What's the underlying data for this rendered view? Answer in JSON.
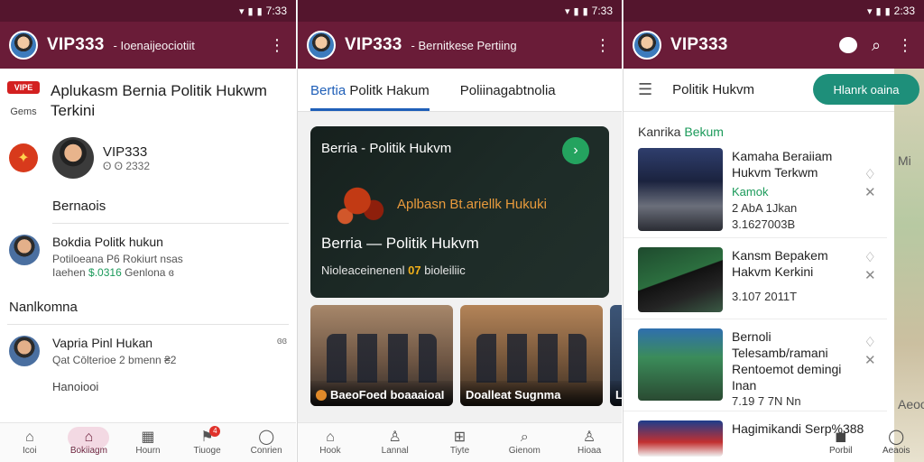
{
  "status": {
    "s1_time": "7:33",
    "s2_time": "7:33",
    "s3_time": "2:33"
  },
  "screen1": {
    "brand": "VIP333",
    "subtitle": "Ioenaijeociotiit",
    "logo_badge": "VIPE",
    "logo_caption": "Gems",
    "hero_title": "Aplukasm Bernia Politik Hukwm Terkini",
    "profile_name": "VIP333",
    "profile_number": "ʘ ʘ 2332",
    "section_label": "Bernaois",
    "item1_title": "Bokdia Politk hukun",
    "item1_line1": "Potiloeana P6 Rokiurt nsas",
    "item1_line2_prefix": "Iaehen",
    "item1_line2_green": "$.0316",
    "item1_line2_suffix": "Genlona ɞ",
    "group_head": "Nanlkomna",
    "item2_title": "Vapria Pinl Hukan",
    "item2_meta": "Qat Cōlterioe  2 bmenn ₴2",
    "item2_trail": "ɞɞ",
    "plain_row": "Hanoiooi",
    "nav": [
      {
        "icon": "⌂",
        "label": "Icoi"
      },
      {
        "icon": "⌂",
        "label": "Bokiiagm"
      },
      {
        "icon": "▦",
        "label": "Hourn"
      },
      {
        "icon": "⚑",
        "label": "Tiuoge"
      },
      {
        "icon": "◯",
        "label": "Conrien"
      }
    ],
    "nav_badge": "4"
  },
  "screen2": {
    "brand": "VIP333",
    "subtitle": "Bernitkese Pertiing",
    "tab_active_a": "Bertia",
    "tab_active_b": "Politk Hakum",
    "tab_2": "Poliinagabtnolia",
    "feature_tag": "Berria - Politik Hukvm",
    "feature_art_text": "Aplbasn Bt.ariellk Hukuki",
    "feature_headline": "Berria — Politik Hukvm",
    "feature_meta_prefix": "Nioleaceinenenl",
    "feature_meta_num": "07",
    "feature_meta_suffix": "bioleiliic",
    "thumb1_caption": "BaeoFoed boaaaioaI",
    "thumb2_caption": "Doalleat Sugnma",
    "thumb3_caption": "Liedo",
    "nav": [
      {
        "icon": "⌂",
        "label": "Hook"
      },
      {
        "icon": "♙",
        "label": "Lannal"
      },
      {
        "icon": "⊞",
        "label": "Tiyte"
      },
      {
        "icon": "⌕",
        "label": "Gienom"
      },
      {
        "icon": "♙",
        "label": "Hioaa"
      }
    ]
  },
  "screen3": {
    "brand": "VIP333",
    "filter_title": "Politik Hukvm",
    "pill_label": "Hlanrk oaina",
    "category_prefix": "Kanrika",
    "category_green": "Bekum",
    "articles": [
      {
        "title": "Kamaha Beraiiam Hukvm Terkwm",
        "tag": "Kamok",
        "meta1": "2 AbA 1Jkan",
        "meta2": "3.1627003B"
      },
      {
        "title": "Kansm Bepakem Hakvm Kerkini",
        "tag": "",
        "meta1": "3.107  2011T",
        "meta2": ""
      },
      {
        "title": "Bernoli Telesamb/ramani Rentoemot demingi Inan",
        "tag": "",
        "meta1": "7.19 7 7N Nn",
        "meta2": ""
      },
      {
        "title": "Hagimikandi Serp%388",
        "tag": "",
        "meta1": "",
        "meta2": ""
      }
    ],
    "nav": [
      {
        "icon": "◼",
        "label": "Porbil"
      },
      {
        "icon": "◯",
        "label": "Aeaois"
      }
    ],
    "side_labels": [
      "Mi",
      "Aeoo"
    ]
  }
}
